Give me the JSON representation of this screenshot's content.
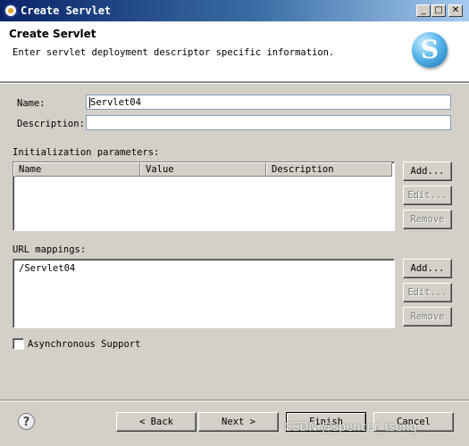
{
  "window": {
    "title": "Create Servlet",
    "controls": {
      "minimize": "_",
      "maximize": "□",
      "close": "✕"
    }
  },
  "header": {
    "title": "Create Servlet",
    "message": "Enter servlet deployment descriptor specific information.",
    "logo_letter": "S",
    "logo_icon": "servlet-wizard-icon"
  },
  "form": {
    "name_label": "Name:",
    "name_value": "Servlet04",
    "description_label": "Description:",
    "description_value": ""
  },
  "init_params": {
    "label": "Initialization parameters:",
    "columns": [
      "Name",
      "Value",
      "Description"
    ],
    "rows": [],
    "buttons": {
      "add": "Add...",
      "edit": "Edit...",
      "remove": "Remove"
    }
  },
  "url_mappings": {
    "label": "URL mappings:",
    "items": [
      "/Servlet04"
    ],
    "buttons": {
      "add": "Add...",
      "edit": "Edit...",
      "remove": "Remove"
    }
  },
  "async": {
    "label": "Asynchronous Support",
    "checked": false
  },
  "footer": {
    "help_glyph": "?",
    "back": "< Back",
    "next": "Next >",
    "finish": "Finish",
    "cancel": "Cancel"
  },
  "watermark": "CSDN @spencer_tseng"
}
